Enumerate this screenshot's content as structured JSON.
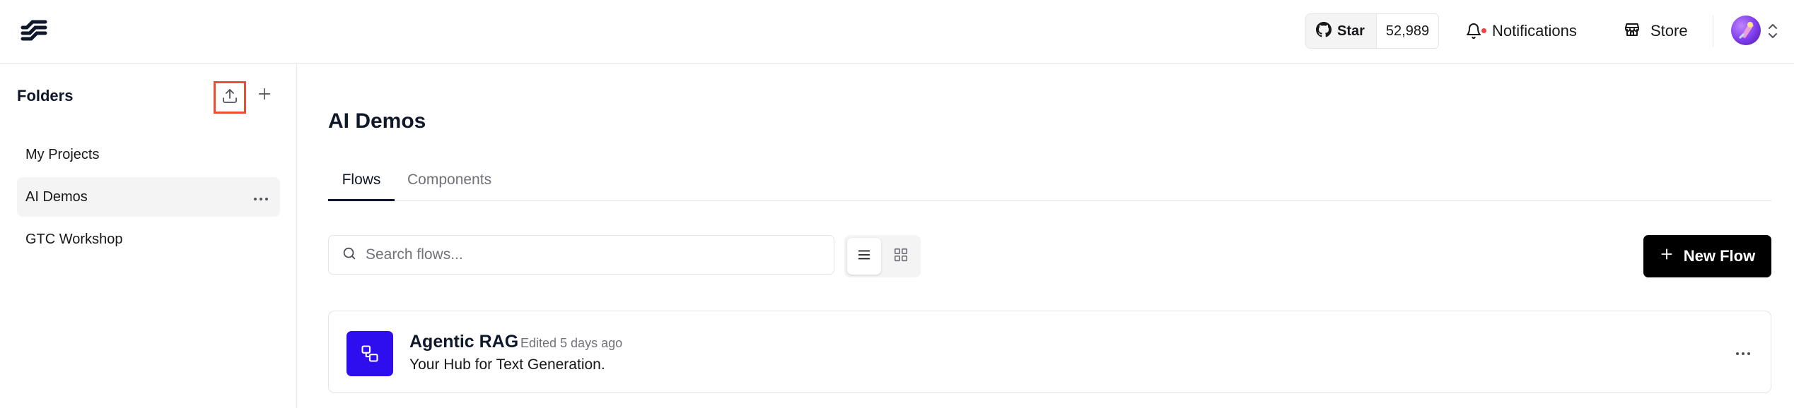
{
  "header": {
    "github": {
      "star_label": "Star",
      "star_count": "52,989"
    },
    "notifications_label": "Notifications",
    "store_label": "Store"
  },
  "sidebar": {
    "title": "Folders",
    "folders": [
      {
        "label": "My Projects",
        "active": false
      },
      {
        "label": "AI Demos",
        "active": true
      },
      {
        "label": "GTC Workshop",
        "active": false
      }
    ]
  },
  "main": {
    "title": "AI Demos",
    "tabs": [
      {
        "label": "Flows",
        "active": true
      },
      {
        "label": "Components",
        "active": false
      }
    ],
    "search": {
      "placeholder": "Search flows...",
      "value": ""
    },
    "view_mode": "list",
    "new_flow_label": "New Flow",
    "flows": [
      {
        "name": "Agentic RAG",
        "edited": "Edited 5 days ago",
        "description": "Your Hub for Text Generation."
      }
    ]
  },
  "colors": {
    "accent_highlight": "#e8502f",
    "flow_icon_bg": "#2e0eef",
    "notification_dot": "#ef4444",
    "primary_button_bg": "#000000"
  },
  "icons": {
    "logo": "langflow-logo-icon",
    "github": "github-icon",
    "notifications": "bell-icon",
    "store": "store-icon",
    "export": "upload-icon",
    "add": "plus-icon",
    "folder_menu": "ellipsis-icon",
    "search": "search-icon",
    "list_view": "list-icon",
    "grid_view": "grid-icon",
    "flow": "group-icon"
  }
}
